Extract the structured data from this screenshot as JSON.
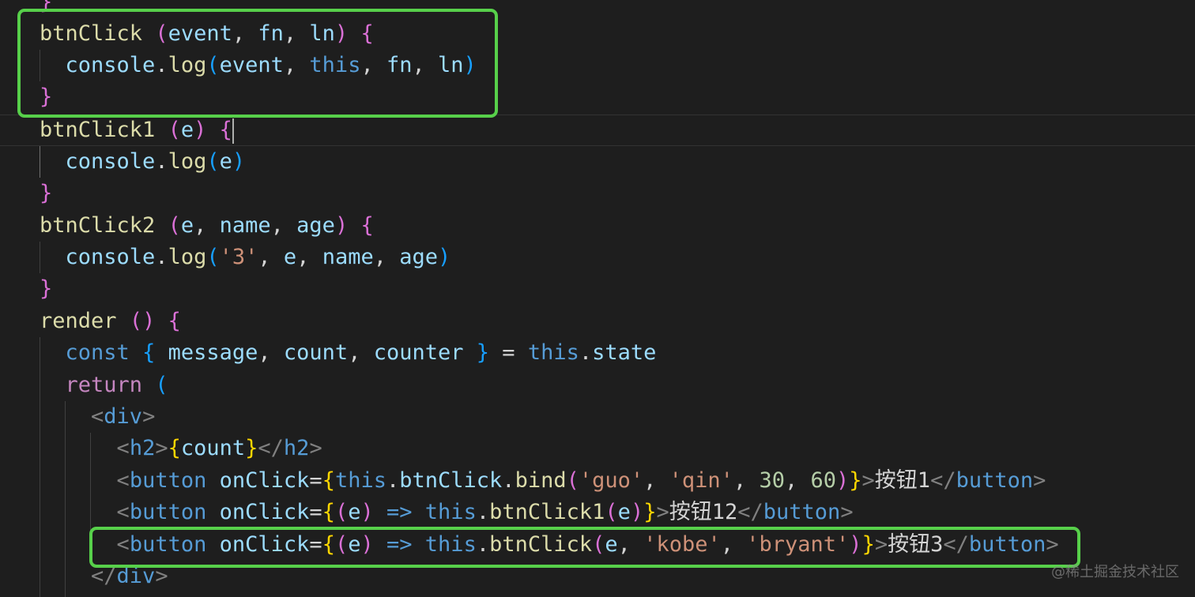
{
  "colors": {
    "background": "#1e1e1e",
    "highlight_box": "#57d04a",
    "function": "#dcdcaa",
    "variable": "#9cdcfe",
    "keyword_blue": "#569cd6",
    "keyword_pink": "#c586c0",
    "string": "#ce9178",
    "number": "#b5cea8",
    "tag_bracket": "#808080",
    "bracket_gold": "#ffd700",
    "bracket_pink": "#da70d6",
    "bracket_blue": "#179fff",
    "plain": "#d4d4d4"
  },
  "watermark": "@稀土掘金技术社区",
  "lines": [
    [
      {
        "t": "}",
        "c": "bracket_pink"
      }
    ],
    [
      {
        "t": "btnClick",
        "c": "function"
      },
      {
        "t": " ",
        "c": "plain"
      },
      {
        "t": "(",
        "c": "bracket_pink"
      },
      {
        "t": "event",
        "c": "variable"
      },
      {
        "t": ", ",
        "c": "plain"
      },
      {
        "t": "fn",
        "c": "variable"
      },
      {
        "t": ", ",
        "c": "plain"
      },
      {
        "t": "ln",
        "c": "variable"
      },
      {
        "t": ")",
        "c": "bracket_pink"
      },
      {
        "t": " ",
        "c": "plain"
      },
      {
        "t": "{",
        "c": "bracket_pink"
      }
    ],
    [
      {
        "t": "  ",
        "c": "plain"
      },
      {
        "t": "console",
        "c": "variable"
      },
      {
        "t": ".",
        "c": "plain"
      },
      {
        "t": "log",
        "c": "function"
      },
      {
        "t": "(",
        "c": "bracket_blue"
      },
      {
        "t": "event",
        "c": "variable"
      },
      {
        "t": ", ",
        "c": "plain"
      },
      {
        "t": "this",
        "c": "keyword_blue"
      },
      {
        "t": ", ",
        "c": "plain"
      },
      {
        "t": "fn",
        "c": "variable"
      },
      {
        "t": ", ",
        "c": "plain"
      },
      {
        "t": "ln",
        "c": "variable"
      },
      {
        "t": ")",
        "c": "bracket_blue"
      }
    ],
    [
      {
        "t": "}",
        "c": "bracket_pink"
      }
    ],
    [
      {
        "t": "btnClick1",
        "c": "function"
      },
      {
        "t": " ",
        "c": "plain"
      },
      {
        "t": "(",
        "c": "bracket_pink"
      },
      {
        "t": "e",
        "c": "variable"
      },
      {
        "t": ")",
        "c": "bracket_pink"
      },
      {
        "t": " ",
        "c": "plain"
      },
      {
        "t": "{",
        "c": "bracket_pink"
      }
    ],
    [
      {
        "t": "  ",
        "c": "plain"
      },
      {
        "t": "console",
        "c": "variable"
      },
      {
        "t": ".",
        "c": "plain"
      },
      {
        "t": "log",
        "c": "function"
      },
      {
        "t": "(",
        "c": "bracket_blue"
      },
      {
        "t": "e",
        "c": "variable"
      },
      {
        "t": ")",
        "c": "bracket_blue"
      }
    ],
    [
      {
        "t": "}",
        "c": "bracket_pink"
      }
    ],
    [
      {
        "t": "btnClick2",
        "c": "function"
      },
      {
        "t": " ",
        "c": "plain"
      },
      {
        "t": "(",
        "c": "bracket_pink"
      },
      {
        "t": "e",
        "c": "variable"
      },
      {
        "t": ", ",
        "c": "plain"
      },
      {
        "t": "name",
        "c": "variable"
      },
      {
        "t": ", ",
        "c": "plain"
      },
      {
        "t": "age",
        "c": "variable"
      },
      {
        "t": ")",
        "c": "bracket_pink"
      },
      {
        "t": " ",
        "c": "plain"
      },
      {
        "t": "{",
        "c": "bracket_pink"
      }
    ],
    [
      {
        "t": "  ",
        "c": "plain"
      },
      {
        "t": "console",
        "c": "variable"
      },
      {
        "t": ".",
        "c": "plain"
      },
      {
        "t": "log",
        "c": "function"
      },
      {
        "t": "(",
        "c": "bracket_blue"
      },
      {
        "t": "'3'",
        "c": "string"
      },
      {
        "t": ", ",
        "c": "plain"
      },
      {
        "t": "e",
        "c": "variable"
      },
      {
        "t": ", ",
        "c": "plain"
      },
      {
        "t": "name",
        "c": "variable"
      },
      {
        "t": ", ",
        "c": "plain"
      },
      {
        "t": "age",
        "c": "variable"
      },
      {
        "t": ")",
        "c": "bracket_blue"
      }
    ],
    [
      {
        "t": "}",
        "c": "bracket_pink"
      }
    ],
    [
      {
        "t": "render",
        "c": "function"
      },
      {
        "t": " ",
        "c": "plain"
      },
      {
        "t": "()",
        "c": "bracket_pink"
      },
      {
        "t": " ",
        "c": "plain"
      },
      {
        "t": "{",
        "c": "bracket_pink"
      }
    ],
    [
      {
        "t": "  ",
        "c": "plain"
      },
      {
        "t": "const",
        "c": "keyword_blue"
      },
      {
        "t": " ",
        "c": "plain"
      },
      {
        "t": "{",
        "c": "bracket_blue"
      },
      {
        "t": " ",
        "c": "plain"
      },
      {
        "t": "message",
        "c": "variable"
      },
      {
        "t": ", ",
        "c": "plain"
      },
      {
        "t": "count",
        "c": "variable"
      },
      {
        "t": ", ",
        "c": "plain"
      },
      {
        "t": "counter",
        "c": "variable"
      },
      {
        "t": " ",
        "c": "plain"
      },
      {
        "t": "}",
        "c": "bracket_blue"
      },
      {
        "t": " = ",
        "c": "plain"
      },
      {
        "t": "this",
        "c": "keyword_blue"
      },
      {
        "t": ".",
        "c": "plain"
      },
      {
        "t": "state",
        "c": "variable"
      }
    ],
    [
      {
        "t": "  ",
        "c": "plain"
      },
      {
        "t": "return",
        "c": "keyword_pink"
      },
      {
        "t": " ",
        "c": "plain"
      },
      {
        "t": "(",
        "c": "bracket_blue"
      }
    ],
    [
      {
        "t": "    ",
        "c": "plain"
      },
      {
        "t": "<",
        "c": "tag_bracket"
      },
      {
        "t": "div",
        "c": "keyword_blue"
      },
      {
        "t": ">",
        "c": "tag_bracket"
      }
    ],
    [
      {
        "t": "      ",
        "c": "plain"
      },
      {
        "t": "<",
        "c": "tag_bracket"
      },
      {
        "t": "h2",
        "c": "keyword_blue"
      },
      {
        "t": ">",
        "c": "tag_bracket"
      },
      {
        "t": "{",
        "c": "bracket_gold"
      },
      {
        "t": "count",
        "c": "variable"
      },
      {
        "t": "}",
        "c": "bracket_gold"
      },
      {
        "t": "</",
        "c": "tag_bracket"
      },
      {
        "t": "h2",
        "c": "keyword_blue"
      },
      {
        "t": ">",
        "c": "tag_bracket"
      }
    ],
    [
      {
        "t": "      ",
        "c": "plain"
      },
      {
        "t": "<",
        "c": "tag_bracket"
      },
      {
        "t": "button",
        "c": "keyword_blue"
      },
      {
        "t": " ",
        "c": "plain"
      },
      {
        "t": "onClick",
        "c": "variable"
      },
      {
        "t": "=",
        "c": "plain"
      },
      {
        "t": "{",
        "c": "bracket_gold"
      },
      {
        "t": "this",
        "c": "keyword_blue"
      },
      {
        "t": ".",
        "c": "plain"
      },
      {
        "t": "btnClick",
        "c": "variable"
      },
      {
        "t": ".",
        "c": "plain"
      },
      {
        "t": "bind",
        "c": "function"
      },
      {
        "t": "(",
        "c": "bracket_pink"
      },
      {
        "t": "'guo'",
        "c": "string"
      },
      {
        "t": ", ",
        "c": "plain"
      },
      {
        "t": "'qin'",
        "c": "string"
      },
      {
        "t": ", ",
        "c": "plain"
      },
      {
        "t": "30",
        "c": "number"
      },
      {
        "t": ", ",
        "c": "plain"
      },
      {
        "t": "60",
        "c": "number"
      },
      {
        "t": ")",
        "c": "bracket_pink"
      },
      {
        "t": "}",
        "c": "bracket_gold"
      },
      {
        "t": ">",
        "c": "tag_bracket"
      },
      {
        "t": "按钮1",
        "c": "plain"
      },
      {
        "t": "</",
        "c": "tag_bracket"
      },
      {
        "t": "button",
        "c": "keyword_blue"
      },
      {
        "t": ">",
        "c": "tag_bracket"
      }
    ],
    [
      {
        "t": "      ",
        "c": "plain"
      },
      {
        "t": "<",
        "c": "tag_bracket"
      },
      {
        "t": "button",
        "c": "keyword_blue"
      },
      {
        "t": " ",
        "c": "plain"
      },
      {
        "t": "onClick",
        "c": "variable"
      },
      {
        "t": "=",
        "c": "plain"
      },
      {
        "t": "{",
        "c": "bracket_gold"
      },
      {
        "t": "(",
        "c": "bracket_pink"
      },
      {
        "t": "e",
        "c": "variable"
      },
      {
        "t": ")",
        "c": "bracket_pink"
      },
      {
        "t": " ",
        "c": "plain"
      },
      {
        "t": "=>",
        "c": "keyword_blue"
      },
      {
        "t": " ",
        "c": "plain"
      },
      {
        "t": "this",
        "c": "keyword_blue"
      },
      {
        "t": ".",
        "c": "plain"
      },
      {
        "t": "btnClick1",
        "c": "function"
      },
      {
        "t": "(",
        "c": "bracket_pink"
      },
      {
        "t": "e",
        "c": "variable"
      },
      {
        "t": ")",
        "c": "bracket_pink"
      },
      {
        "t": "}",
        "c": "bracket_gold"
      },
      {
        "t": ">",
        "c": "tag_bracket"
      },
      {
        "t": "按钮12",
        "c": "plain"
      },
      {
        "t": "</",
        "c": "tag_bracket"
      },
      {
        "t": "button",
        "c": "keyword_blue"
      },
      {
        "t": ">",
        "c": "tag_bracket"
      }
    ],
    [
      {
        "t": "      ",
        "c": "plain"
      },
      {
        "t": "<",
        "c": "tag_bracket"
      },
      {
        "t": "button",
        "c": "keyword_blue"
      },
      {
        "t": " ",
        "c": "plain"
      },
      {
        "t": "onClick",
        "c": "variable"
      },
      {
        "t": "=",
        "c": "plain"
      },
      {
        "t": "{",
        "c": "bracket_gold"
      },
      {
        "t": "(",
        "c": "bracket_pink"
      },
      {
        "t": "e",
        "c": "variable"
      },
      {
        "t": ")",
        "c": "bracket_pink"
      },
      {
        "t": " ",
        "c": "plain"
      },
      {
        "t": "=>",
        "c": "keyword_blue"
      },
      {
        "t": " ",
        "c": "plain"
      },
      {
        "t": "this",
        "c": "keyword_blue"
      },
      {
        "t": ".",
        "c": "plain"
      },
      {
        "t": "btnClick",
        "c": "function"
      },
      {
        "t": "(",
        "c": "bracket_pink"
      },
      {
        "t": "e",
        "c": "variable"
      },
      {
        "t": ", ",
        "c": "plain"
      },
      {
        "t": "'kobe'",
        "c": "string"
      },
      {
        "t": ", ",
        "c": "plain"
      },
      {
        "t": "'bryant'",
        "c": "string"
      },
      {
        "t": ")",
        "c": "bracket_pink"
      },
      {
        "t": "}",
        "c": "bracket_gold"
      },
      {
        "t": ">",
        "c": "tag_bracket"
      },
      {
        "t": "按钮3",
        "c": "plain"
      },
      {
        "t": "</",
        "c": "tag_bracket"
      },
      {
        "t": "button",
        "c": "keyword_blue"
      },
      {
        "t": ">",
        "c": "tag_bracket"
      }
    ],
    [
      {
        "t": "    ",
        "c": "plain"
      },
      {
        "t": "</",
        "c": "tag_bracket"
      },
      {
        "t": "div",
        "c": "keyword_blue"
      },
      {
        "t": ">",
        "c": "tag_bracket"
      }
    ]
  ]
}
